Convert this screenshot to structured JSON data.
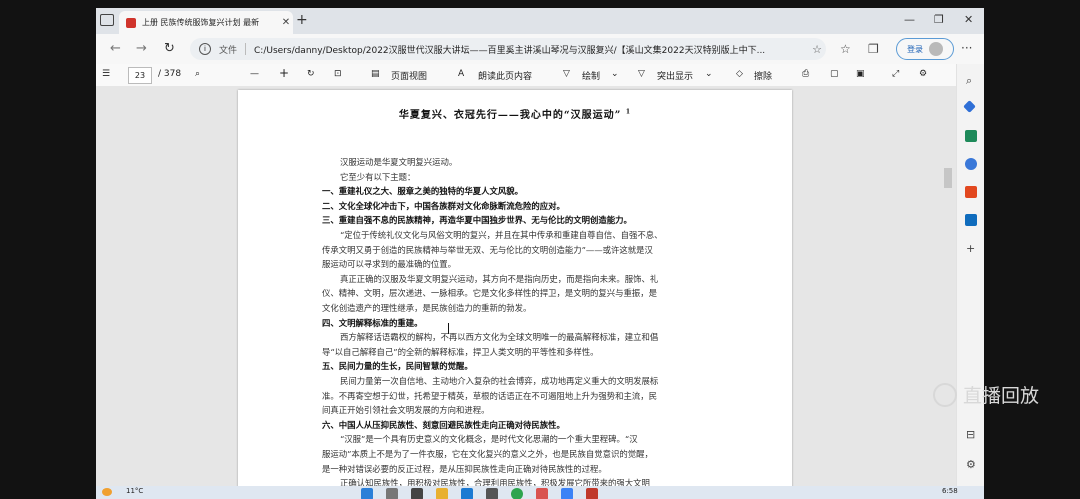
{
  "browser": {
    "tab_title": "上册 民族传统服饰复兴计划 最新",
    "tab_close": "✕",
    "new_tab": "+",
    "window_controls": [
      "—",
      "❐",
      "✕"
    ],
    "back": "←",
    "forward": "→",
    "refresh": "↻",
    "file_label": "文件",
    "url": "C:/Users/danny/Desktop/2022汉服世代汉服大讲坛——百里奚主讲溪山琴况与汉服复兴/【溪山文集2022天汉特别版上中下...",
    "login_label": "登录",
    "more": "···"
  },
  "pdf_toolbar": {
    "page_current": "23",
    "page_total": "/ 378",
    "zoom_out": "—",
    "zoom_in": "+",
    "page_view": "页面视图",
    "read_aloud": "朗读此页内容",
    "draw": "绘制",
    "highlight": "突出显示",
    "erase": "擦除"
  },
  "document": {
    "title": "华夏复兴、衣冠先行——我心中的“汉服运动”",
    "footnote_mark": "1",
    "lines": [
      {
        "text": "汉服运动是华夏文明复兴运动。",
        "bold": false,
        "indent": true
      },
      {
        "text": "它至少有以下主题：",
        "bold": false,
        "indent": true
      },
      {
        "text": "一、重建礼仪之大、服章之美的独特的华夏人文风貌。",
        "bold": true,
        "indent": false
      },
      {
        "text": "二、文化全球化冲击下，中国各族群对文化命脉断流危险的应对。",
        "bold": true,
        "indent": false
      },
      {
        "text": "三、重建自强不息的民族精神，再造华夏中国独步世界、无与伦比的文明创造能力。",
        "bold": true,
        "indent": false
      },
      {
        "text": "“定位于传统礼仪文化与风俗文明的复兴，并且在其中传承和重建自尊自信、自强不息、",
        "bold": false,
        "indent": true
      },
      {
        "text": "传承文明又勇于创造的民族精神与举世无双、无与伦比的文明创造能力”——或许这就是汉",
        "bold": false,
        "indent": false
      },
      {
        "text": "服运动可以寻求到的最准确的位置。",
        "bold": false,
        "indent": false
      },
      {
        "text": "真正正确的汉服及华夏文明复兴运动，其方向不是指向历史，而是指向未来。服饰、礼",
        "bold": false,
        "indent": true
      },
      {
        "text": "仪、精神、文明，层次递进、一脉相承。它是文化多样性的捍卫，是文明的复兴与重振，是",
        "bold": false,
        "indent": false
      },
      {
        "text": "文化创造遗产的理性继承，是民族创造力的重新的勃发。",
        "bold": false,
        "indent": false
      },
      {
        "text": "四、文明解释标准的重建。",
        "bold": true,
        "indent": false
      },
      {
        "text": "西方解释话语霸权的解构，不再以西方文化为全球文明唯一的最高解释标准，建立和倡",
        "bold": false,
        "indent": true
      },
      {
        "text": "导“以自己解释自己”的全新的解释标准，捍卫人类文明的平等性和多样性。",
        "bold": false,
        "indent": false
      },
      {
        "text": "五、民间力量的生长，民间智慧的觉醒。",
        "bold": true,
        "indent": false
      },
      {
        "text": "民间力量第一次自信地、主动地介入复杂的社会博弈，成功地再定义重大的文明发展标",
        "bold": false,
        "indent": true
      },
      {
        "text": "准。不再寄空想于幻世，托希望于精英，草根的话语正在不可遏阻地上升为强势和主流，民",
        "bold": false,
        "indent": false
      },
      {
        "text": "间真正开始引领社会文明发展的方向和进程。",
        "bold": false,
        "indent": false
      },
      {
        "text": "六、中国人从压抑民族性、刻意回避民族性走向正确对待民族性。",
        "bold": true,
        "indent": false
      },
      {
        "text": "“汉服”是一个具有历史意义的文化概念，是时代文化思潮的一个重大里程碑。“汉",
        "bold": false,
        "indent": true
      },
      {
        "text": "服运动”本质上不是为了一件衣服，它在文化复兴的意义之外，也是民族自觉意识的觉醒，",
        "bold": false,
        "indent": false
      },
      {
        "text": "是一种对错误必要的反正过程，是从压抑民族性走向正确对待民族性的过程。",
        "bold": false,
        "indent": false
      },
      {
        "text": "正确认知民族性，用积极对民族性，合理利用民族性，积极发展它所带来的强大文明",
        "bold": false,
        "indent": true
      }
    ]
  },
  "taskbar": {
    "weather": "11°C",
    "clock": "6:58"
  },
  "overlay": {
    "replay_label": "直播回放"
  }
}
